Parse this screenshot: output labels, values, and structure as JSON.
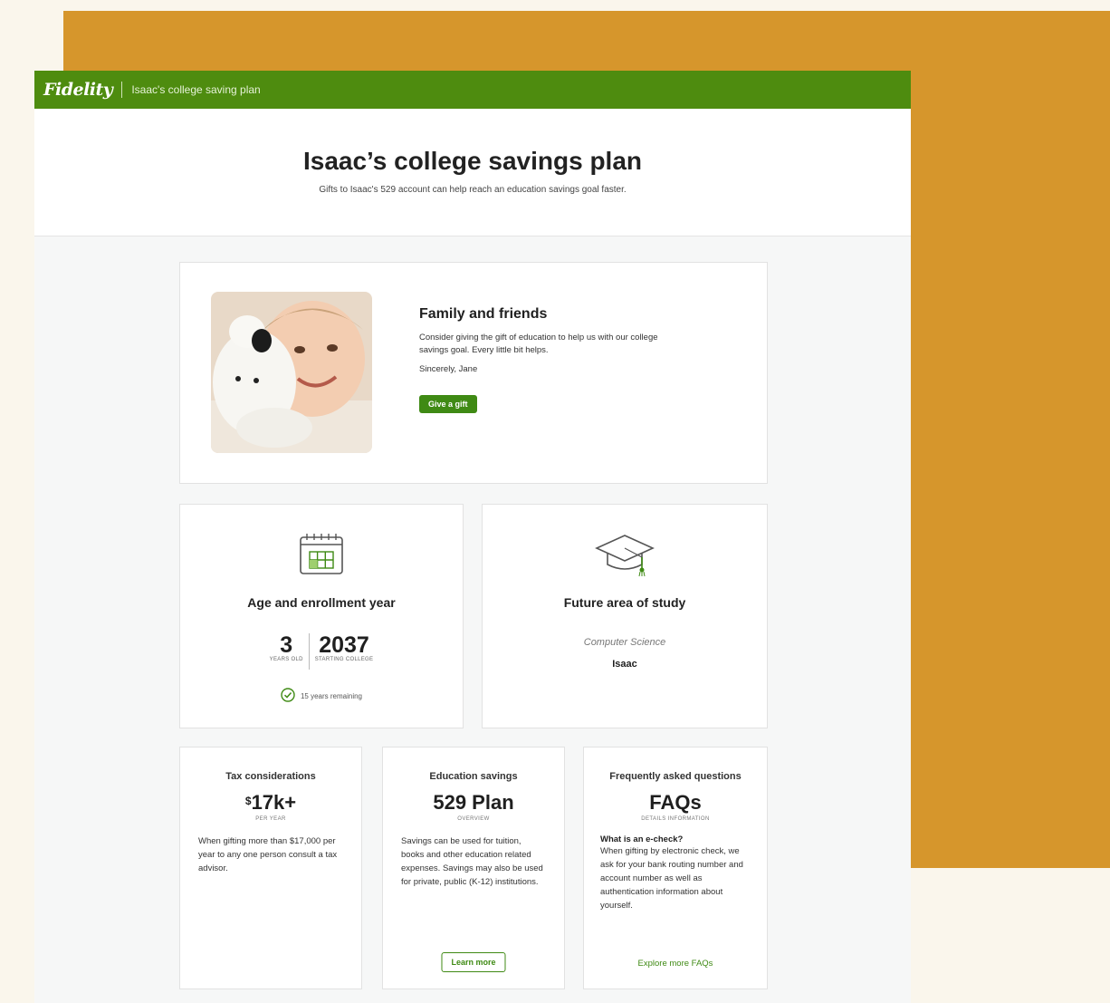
{
  "header": {
    "brand": "Fidelity",
    "page_label": "Isaac's college saving plan"
  },
  "hero": {
    "title": "Isaac’s college savings plan",
    "subtitle": "Gifts to Isaac's 529 account can help reach an education savings goal faster."
  },
  "friends_card": {
    "title": "Family and friends",
    "body": "Consider giving the gift of education to help us with our college savings goal. Every little bit helps.",
    "signature": "Sincerely, Jane",
    "button_label": "Give a gift"
  },
  "age_card": {
    "title": "Age and enrollment year",
    "age_value": "3",
    "age_label": "YEARS OLD",
    "year_value": "2037",
    "year_label": "STARTING COLLEGE",
    "remaining_text": "15 years remaining"
  },
  "study_card": {
    "title": "Future area of study",
    "field": "Computer Science",
    "name": "Isaac"
  },
  "tax_card": {
    "title": "Tax considerations",
    "currency": "$",
    "amount": "17k+",
    "sub": "PER YEAR",
    "body": "When gifting more than $17,000 per year to any one person consult a tax advisor."
  },
  "edu_card": {
    "title": "Education savings",
    "value": "529 Plan",
    "sub": "OVERVIEW",
    "body": "Savings can be used for tuition, books and other education related expenses. Savings may also be used for private, public (K-12) institutions.",
    "button_label": "Learn more"
  },
  "faq_card": {
    "title": "Frequently asked questions",
    "value": "FAQs",
    "sub": "DETAILS INFORMATION",
    "question": "What is an e-check?",
    "answer": "When gifting by electronic check, we ask for your bank routing number and account number as well as authentication information about yourself.",
    "link_label": "Explore more FAQs"
  },
  "colors": {
    "brand_green": "#4e8c0f",
    "accent_green": "#3f8a14",
    "backdrop": "#d6962c"
  },
  "icons": {
    "calendar": "calendar-icon",
    "graduation": "graduation-cap-icon",
    "check": "check-circle-icon"
  }
}
